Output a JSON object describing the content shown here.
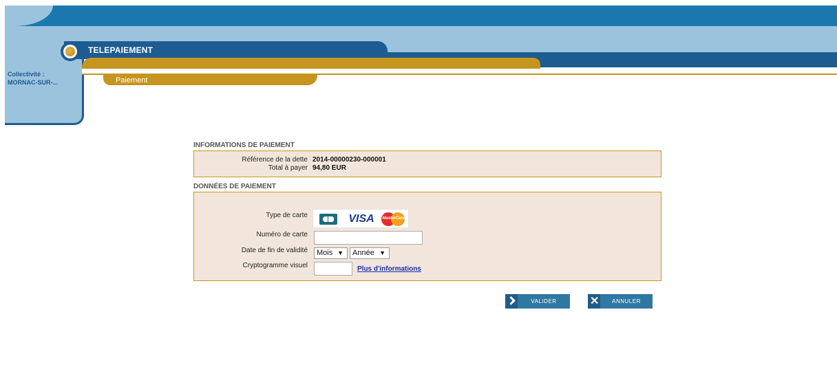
{
  "header": {
    "title": "TELEPAIEMENT",
    "subtab": "Paiement"
  },
  "sidebar": {
    "collectivite_label": "Collectivité :",
    "collectivite_value": "MORNAC-SUR-..."
  },
  "payment_info": {
    "section_title": "INFORMATIONS DE PAIEMENT",
    "reference_label": "Référence de la dette",
    "reference_value": "2014-00000230-000001",
    "total_label": "Total à payer",
    "total_value": "94,80 EUR"
  },
  "payment_data": {
    "section_title": "DONNÉES DE PAIEMENT",
    "card_type_label": "Type de carte",
    "card_types": [
      "cb-icon",
      "visa-icon",
      "mastercard-icon"
    ],
    "visa_text": "VISA",
    "mastercard_text": "MasterCard",
    "card_number_label": "Numéro de carte",
    "card_number_value": "",
    "expiry_label": "Date de fin de validité",
    "month_select": "Mois",
    "year_select": "Année",
    "cvv_label": "Cryptogramme visuel",
    "cvv_value": "",
    "more_info_link": "Plus d'informations"
  },
  "actions": {
    "validate_label": "VALIDER",
    "cancel_label": "ANNULER"
  },
  "colors": {
    "header_blue": "#1a78ae",
    "light_blue": "#9cc3dd",
    "dark_blue": "#1d5c92",
    "gold": "#c5951f",
    "form_bg": "#f2e6dc",
    "button_blue": "#2f78a2"
  }
}
